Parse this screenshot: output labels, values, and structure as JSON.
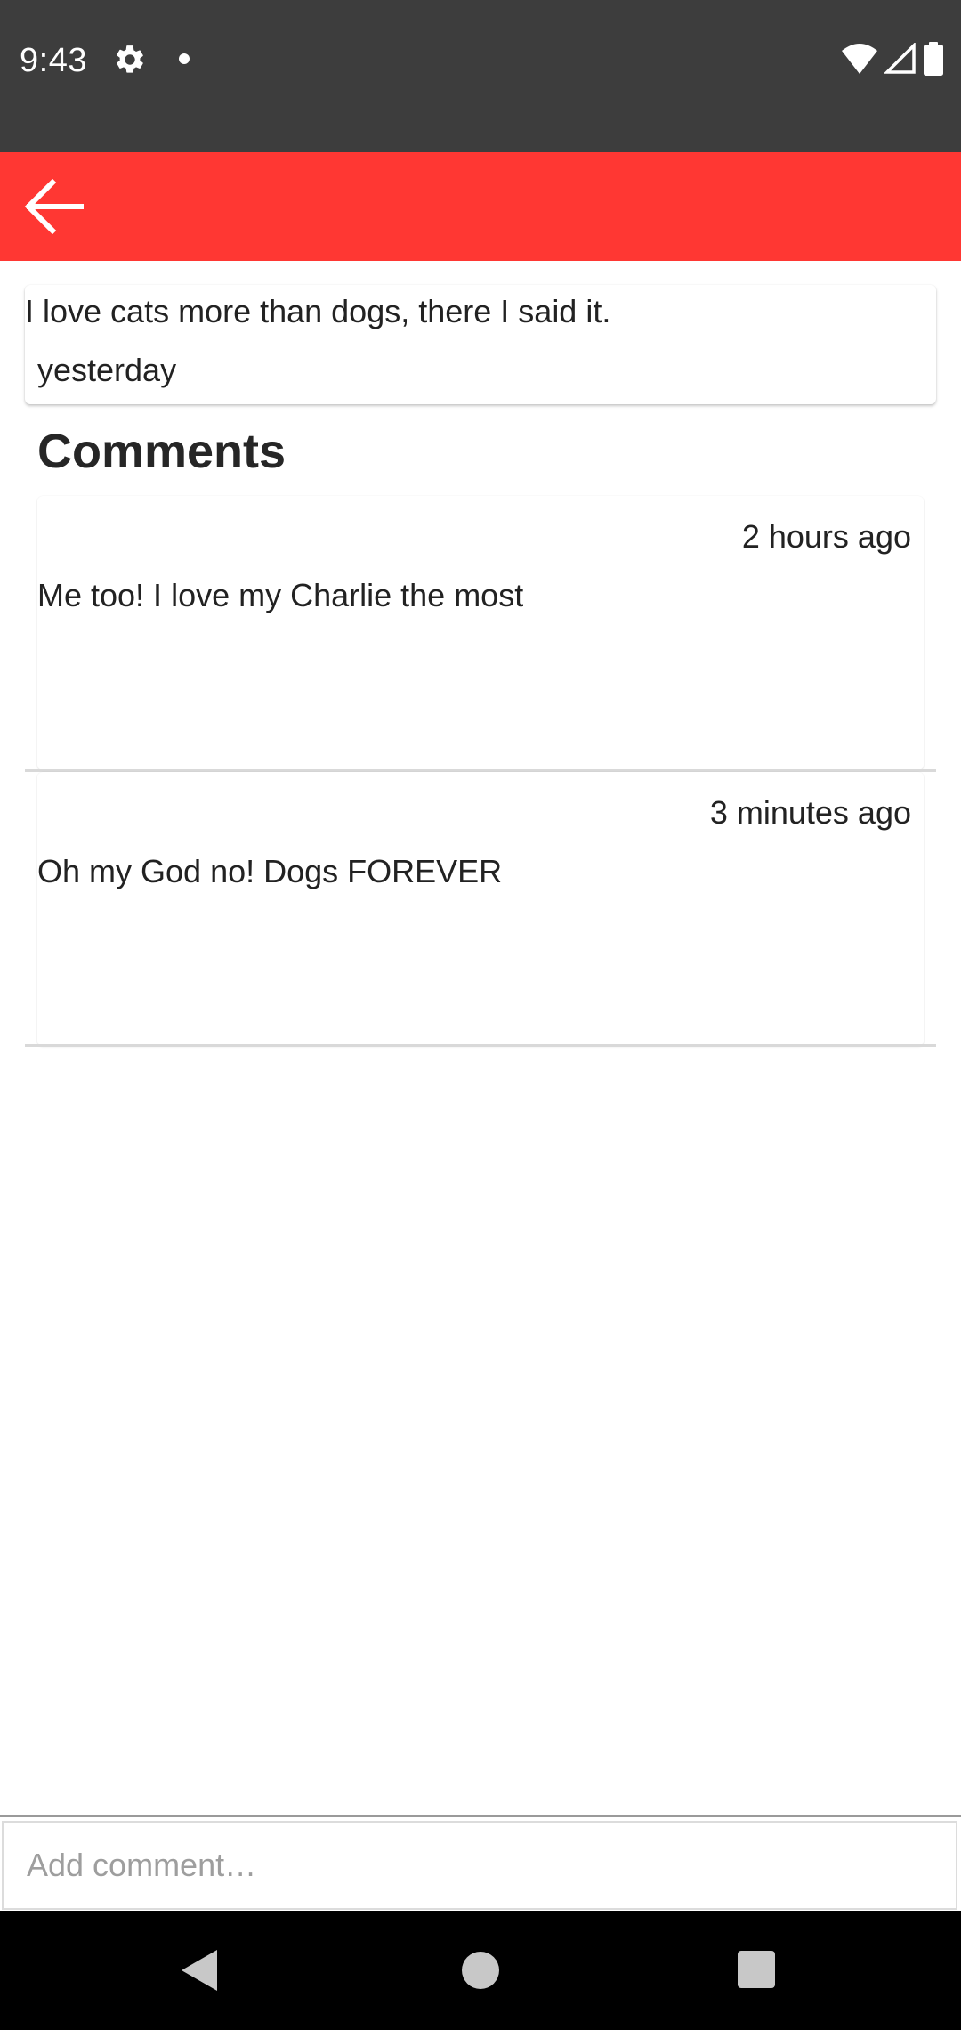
{
  "status_bar": {
    "time": "9:43",
    "icons": [
      "gear-icon",
      "notification-dot-icon",
      "wifi-icon",
      "cellular-signal-icon",
      "battery-icon"
    ]
  },
  "app_bar": {
    "color": "#ff3733",
    "back_icon": "arrow-back-icon"
  },
  "post": {
    "text": "I love cats more than dogs, there I said it.",
    "time": "yesterday"
  },
  "comments": {
    "heading": "Comments",
    "items": [
      {
        "time": "2 hours ago",
        "text": "Me too! I love my Charlie the most"
      },
      {
        "time": "3 minutes ago",
        "text": "Oh my God no! Dogs FOREVER"
      }
    ]
  },
  "input": {
    "placeholder": "Add comment…",
    "value": ""
  },
  "nav_bar": {
    "icons": [
      "nav-back-icon",
      "nav-home-icon",
      "nav-recents-icon"
    ]
  }
}
